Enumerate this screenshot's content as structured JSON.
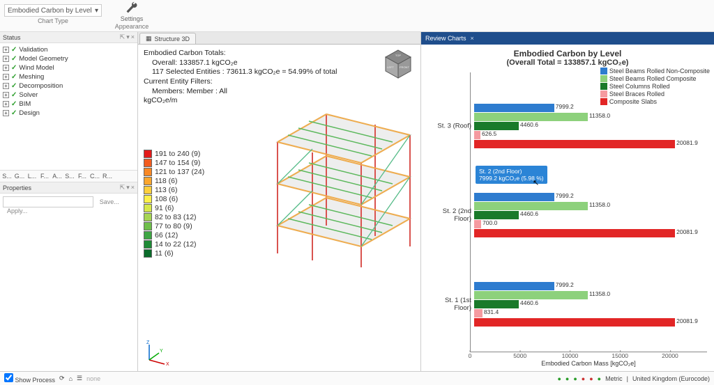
{
  "ribbon": {
    "chart_type_dropdown": "Embodied Carbon by Level",
    "chart_type_group": "Chart Type",
    "settings_label": "Settings",
    "appearance_group": "Appearance"
  },
  "panels": {
    "status_title": "Status",
    "properties_title": "Properties",
    "save_label": "Save...",
    "apply_label": "Apply..."
  },
  "tree": [
    {
      "label": "Validation"
    },
    {
      "label": "Model Geometry"
    },
    {
      "label": "Wind Model"
    },
    {
      "label": "Meshing"
    },
    {
      "label": "Decomposition"
    },
    {
      "label": "Solver"
    },
    {
      "label": "BIM"
    },
    {
      "label": "Design"
    }
  ],
  "toolbar_icons": [
    "S...",
    "G...",
    "L...",
    "F...",
    "A...",
    "S...",
    "F...",
    "C...",
    "R..."
  ],
  "center_tab": "Structure 3D",
  "info": {
    "l1": "Embodied Carbon Totals:",
    "l2": "Overall: 133857.1 kgCO₂e",
    "l3": "117 Selected Entities : 73611.3 kgCO₂e = 54.99% of total",
    "l4": "Current Entity Filters:",
    "l5": "Members: Member : All",
    "l6": "kgCO₂e/m"
  },
  "legend_3d": [
    {
      "color": "#e31a1a",
      "label": "191 to 240 (9)"
    },
    {
      "color": "#f25c1f",
      "label": "147 to 154 (9)"
    },
    {
      "color": "#f98825",
      "label": "121 to 137 (24)"
    },
    {
      "color": "#fca62e",
      "label": "118 (6)"
    },
    {
      "color": "#ffcf3d",
      "label": "113 (6)"
    },
    {
      "color": "#fff04a",
      "label": "108 (6)"
    },
    {
      "color": "#d7e84a",
      "label": "91 (6)"
    },
    {
      "color": "#a6d553",
      "label": "82 to 83 (12)"
    },
    {
      "color": "#6fbf4b",
      "label": "77 to 80 (9)"
    },
    {
      "color": "#3ea643",
      "label": "66 (12)"
    },
    {
      "color": "#1f8a36",
      "label": "14 to 22 (12)"
    },
    {
      "color": "#0a6b2a",
      "label": "11 (6)"
    }
  ],
  "right_tab": "Review Charts",
  "chart": {
    "title": "Embodied Carbon by Level",
    "subtitle": "(Overall Total = 133857.1 kgCO₂e)",
    "xlabel": "Embodied Carbon Mass [kgCO₂e]",
    "tooltip": "St. 2 (2nd Floor)\n7999.2 kgCO₂e (5.98 %)"
  },
  "chart_legend": [
    {
      "color": "#2e7ccf",
      "label": "Steel Beams Rolled Non-Composite"
    },
    {
      "color": "#8dd17c",
      "label": "Steel Beams Rolled Composite"
    },
    {
      "color": "#1a7a2a",
      "label": "Steel Columns Rolled"
    },
    {
      "color": "#f59aa0",
      "label": "Steel Braces Rolled"
    },
    {
      "color": "#e22626",
      "label": "Composite Slabs"
    }
  ],
  "chart_data": {
    "type": "bar",
    "orientation": "horizontal_grouped",
    "xlabel": "Embodied Carbon Mass [kgCO₂e]",
    "xlim": [
      0,
      23000
    ],
    "xticks": [
      0,
      5000,
      10000,
      15000,
      20000
    ],
    "categories": [
      "St. 3 (Roof)",
      "St. 2 (2nd Floor)",
      "St. 1 (1st Floor)"
    ],
    "series": [
      {
        "name": "Steel Beams Rolled Non-Composite",
        "color": "#2e7ccf",
        "values": [
          7999.2,
          7999.2,
          7999.2
        ]
      },
      {
        "name": "Steel Beams Rolled Composite",
        "color": "#8dd17c",
        "values": [
          11358.0,
          11358.0,
          11358.0
        ]
      },
      {
        "name": "Steel Columns Rolled",
        "color": "#1a7a2a",
        "values": [
          4460.6,
          4460.6,
          4460.6
        ]
      },
      {
        "name": "Steel Braces Rolled",
        "color": "#f59aa0",
        "values": [
          626.5,
          700.0,
          831.4
        ]
      },
      {
        "name": "Composite Slabs",
        "color": "#e22626",
        "values": [
          20081.9,
          20081.9,
          20081.9
        ]
      }
    ]
  },
  "status": {
    "show_process": "Show Process",
    "combo": "none",
    "metric": "Metric",
    "region": "United Kingdom (Eurocode)"
  }
}
